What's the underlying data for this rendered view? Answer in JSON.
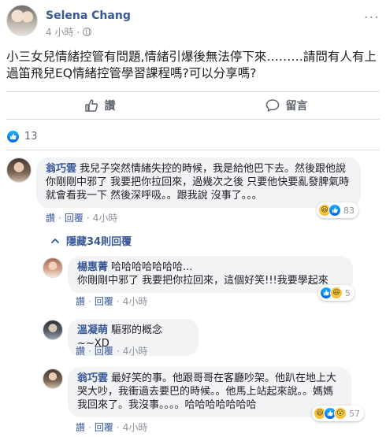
{
  "post": {
    "author": "Selena Chang",
    "time": "4 小時",
    "text": "小三女兒情緒控管有問題,情緒引爆後無法停下來………請問有人有上過笛飛兒EQ情緒控管學習課程嗎?可以分享嗎?"
  },
  "actions": {
    "like": "讚",
    "comment": "留言"
  },
  "reactions": {
    "count": "13"
  },
  "hidden_replies": "隱藏34則回覆",
  "comments": [
    {
      "name": "翁巧雲",
      "text": "我兒子突然情緒失控的時候，我是給他巴下去。然後跟他說 你剛剛中邪了 我要把你拉回來，過幾次之後 只要他快要亂發脾氣時 就會看我一下 然後深呼吸。。跟我說 沒事了。。。",
      "like": "讚",
      "reply": "回覆",
      "time": "4小時",
      "reaction_count": "83"
    },
    {
      "name": "楊惠菁",
      "line1": "哈哈哈哈哈哈哈...",
      "line2": "你剛剛中邪了 我要把你拉回來，這個好笑!!!我要學起來",
      "like": "讚",
      "reply": "回覆",
      "time": "4小時",
      "reaction_count": "5"
    },
    {
      "name": "溫凝萌",
      "text": "驅邪的概念~~XD",
      "like": "讚",
      "reply": "回覆",
      "time": "4小時"
    },
    {
      "name": "翁巧雲",
      "text": "最好笑的事。他跟哥哥在客廳吵架。他趴在地上大哭大吵，我衝過去要巴的時候。。他馬上站起來說。。媽媽我回來了。我沒事。。。。哈哈哈哈哈哈哈",
      "like": "讚",
      "reply": "回覆",
      "time": "4小時",
      "reaction_count": "57"
    }
  ],
  "colors": {
    "link": "#385898",
    "meta": "#90949c",
    "bubble": "#f2f3f5",
    "like_blue": "#1877f2"
  }
}
